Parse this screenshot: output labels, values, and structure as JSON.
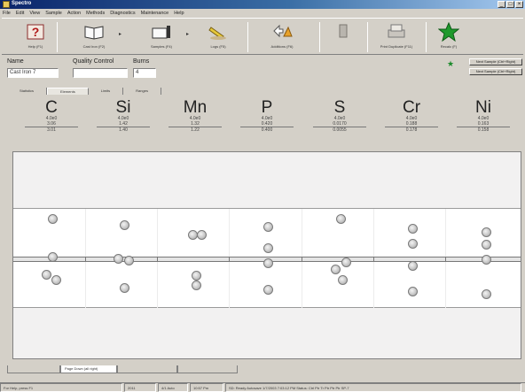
{
  "app": {
    "title": "Spectro"
  },
  "menu": [
    "File",
    "Edit",
    "View",
    "Sample",
    "Action",
    "Methods",
    "Diagnostics",
    "Maintenance",
    "Help"
  ],
  "toolbar": {
    "buttons": [
      {
        "name": "help",
        "label": "Help (F1)"
      },
      {
        "name": "cast-iron",
        "label": "Cast Iron (F2)"
      },
      {
        "name": "samples",
        "label": "Samples (F4)"
      },
      {
        "name": "logs",
        "label": "Logs (F5)"
      },
      {
        "name": "additions",
        "label": "Additions (F6)"
      },
      {
        "name": "disabled",
        "label": ""
      },
      {
        "name": "print-duplicate",
        "label": "Print Duplicate (F11)"
      },
      {
        "name": "recalc",
        "label": "Recalc (F)"
      }
    ]
  },
  "fields": {
    "name_label": "Name",
    "name_value": "Cast Iron 7",
    "qc_label": "Quality Control",
    "qc_value": "",
    "burns_label": "Burns",
    "burns_value": "4"
  },
  "side_buttons": [
    "Next Sample (Ctrl+Right)",
    "Next Sample (Ctrl+Right)"
  ],
  "tabs": [
    "Statistics",
    "Elements",
    "Limits",
    "Ranges"
  ],
  "active_tab": 1,
  "elements": [
    {
      "symbol": "C",
      "v1": "4.0e0",
      "v2": "3.06",
      "v3": "3.01"
    },
    {
      "symbol": "Si",
      "v1": "4.0e0",
      "v2": "1.42",
      "v3": "1.40"
    },
    {
      "symbol": "Mn",
      "v1": "4.0e0",
      "v2": "1.32",
      "v3": "1.22"
    },
    {
      "symbol": "P",
      "v1": "4.0e0",
      "v2": "0.420",
      "v3": "0.400"
    },
    {
      "symbol": "S",
      "v1": "4.0e0",
      "v2": "0.0170",
      "v3": "0.0055"
    },
    {
      "symbol": "Cr",
      "v1": "4.0e0",
      "v2": "0.188",
      "v3": "0.178"
    },
    {
      "symbol": "Ni",
      "v1": "4.0e0",
      "v2": "0.163",
      "v3": "0.158"
    }
  ],
  "bottom_tabs": [
    "",
    "Page Down (all right)",
    "",
    ""
  ],
  "status": [
    "For Help, press F1",
    "2011",
    "4/1 Auto",
    "10:57 Pm",
    "SD: Ready  Autosave 1/7/2003  7:03:12 PM Status: Ctrl  Ptr  Tr  Ptr  Ptr  Ptr  SP-7"
  ]
}
